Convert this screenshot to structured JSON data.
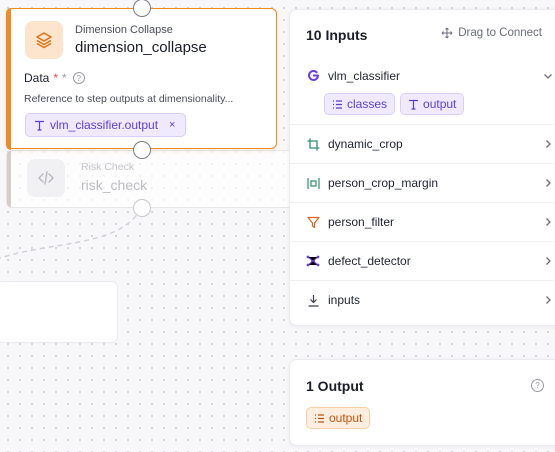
{
  "node": {
    "subtitle": "Dimension Collapse",
    "name": "dimension_collapse",
    "field_label": "Data",
    "required_mark": "*",
    "extra_mark": "*",
    "help": "?",
    "description": "Reference to step outputs at dimensionality...",
    "reference_chip": "vlm_classifier.output",
    "remove_glyph": "×",
    "accent_color": "#f08a24",
    "icon": "layers-icon"
  },
  "next_node": {
    "subtitle": "Risk Check",
    "name": "risk_check",
    "icon": "code-icon"
  },
  "inputs_panel": {
    "title": "10 Inputs",
    "drag_hint": "Drag to Connect",
    "items": [
      {
        "label": "vlm_classifier",
        "icon": "google-g-icon",
        "expanded": true,
        "outputs": [
          {
            "label": "classes",
            "icon": "list-icon"
          },
          {
            "label": "output",
            "icon": "text-t-icon"
          }
        ]
      },
      {
        "label": "dynamic_crop",
        "icon": "crop-icon"
      },
      {
        "label": "person_crop_margin",
        "icon": "margin-icon"
      },
      {
        "label": "person_filter",
        "icon": "filter-icon"
      },
      {
        "label": "defect_detector",
        "icon": "graph-icon"
      },
      {
        "label": "inputs",
        "icon": "download-icon"
      }
    ]
  },
  "outputs_panel": {
    "title": "1 Output",
    "help": "?",
    "chip": "output",
    "chip_icon": "list-icon"
  }
}
